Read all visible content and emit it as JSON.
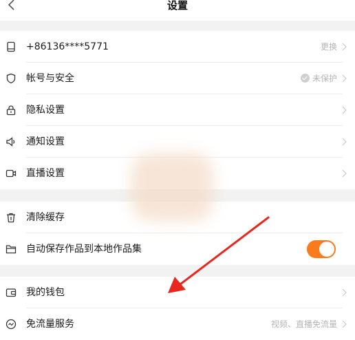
{
  "header": {
    "title": "设置"
  },
  "groups": [
    {
      "items": [
        {
          "icon": "phone-icon",
          "label": "+86136****5771",
          "right": "更换"
        },
        {
          "icon": "shield-icon",
          "label": "帐号与安全",
          "right": "未保护"
        },
        {
          "icon": "lock-icon",
          "label": "隐私设置",
          "right": ""
        },
        {
          "icon": "speaker-icon",
          "label": "通知设置",
          "right": ""
        },
        {
          "icon": "video-icon",
          "label": "直播设置",
          "right": ""
        }
      ]
    },
    {
      "items": [
        {
          "icon": "trash-icon",
          "label": "清除缓存"
        },
        {
          "icon": "folder-icon",
          "label": "自动保存作品到本地作品集",
          "toggle_on": true
        }
      ]
    },
    {
      "items": [
        {
          "icon": "wallet-icon",
          "label": "我的钱包",
          "right": ""
        },
        {
          "icon": "data-flow-icon",
          "label": "免流量服务",
          "right": "视频、直播免流量"
        }
      ]
    }
  ],
  "colors": {
    "accent": "#fb7b1c",
    "annotation_arrow": "#e8281e"
  }
}
